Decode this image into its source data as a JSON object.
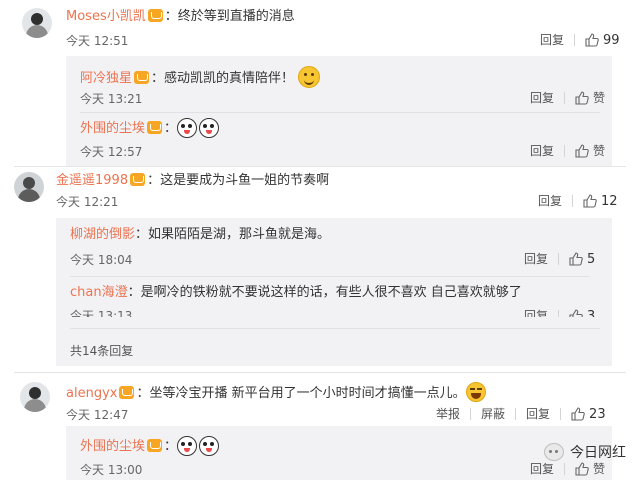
{
  "comments": [
    {
      "user": "Moses小凯凯",
      "text": "终於等到直播的消息",
      "time": "今天 12:51",
      "reply": "回复",
      "likes": "99",
      "replies": [
        {
          "user": "阿冷独星",
          "text": "感动凯凯的真情陪伴！",
          "time": "今天 13:21",
          "reply": "回复",
          "likes": "赞"
        },
        {
          "user": "外围的尘埃",
          "text": "",
          "time": "今天 12:57",
          "reply": "回复",
          "likes": "赞"
        }
      ]
    },
    {
      "user": "金遥遥1998",
      "text": "这是要成为斗鱼一姐的节奏啊",
      "time": "今天 12:21",
      "reply": "回复",
      "likes": "12",
      "replies": [
        {
          "user": "柳湖的倒影",
          "text": "如果陌陌是湖，那斗鱼就是海。",
          "time": "今天 18:04",
          "reply": "回复",
          "likes": "5"
        },
        {
          "user": "chan海澄",
          "text": "是啊冷的铁粉就不要说这样的话，有些人很不喜欢 自己喜欢就够了",
          "time": "今天 13:13",
          "reply": "回复",
          "likes": "3"
        }
      ],
      "more": "共14条回复"
    },
    {
      "user": "alengyx",
      "text": "坐等冷宝开播 新平台用了一个小时时间才搞懂一点儿。",
      "time": "今天 12:47",
      "report": "举报",
      "block": "屏蔽",
      "reply": "回复",
      "likes": "23",
      "replies": [
        {
          "user": "外围的尘埃",
          "text": "",
          "time": "今天 13:00",
          "reply": "回复",
          "likes": "赞"
        }
      ]
    }
  ],
  "watermark": "今日网红",
  "colors": {
    "username": "#eb7350",
    "vip": "#f6a623",
    "subBg": "#f2f2f5"
  }
}
